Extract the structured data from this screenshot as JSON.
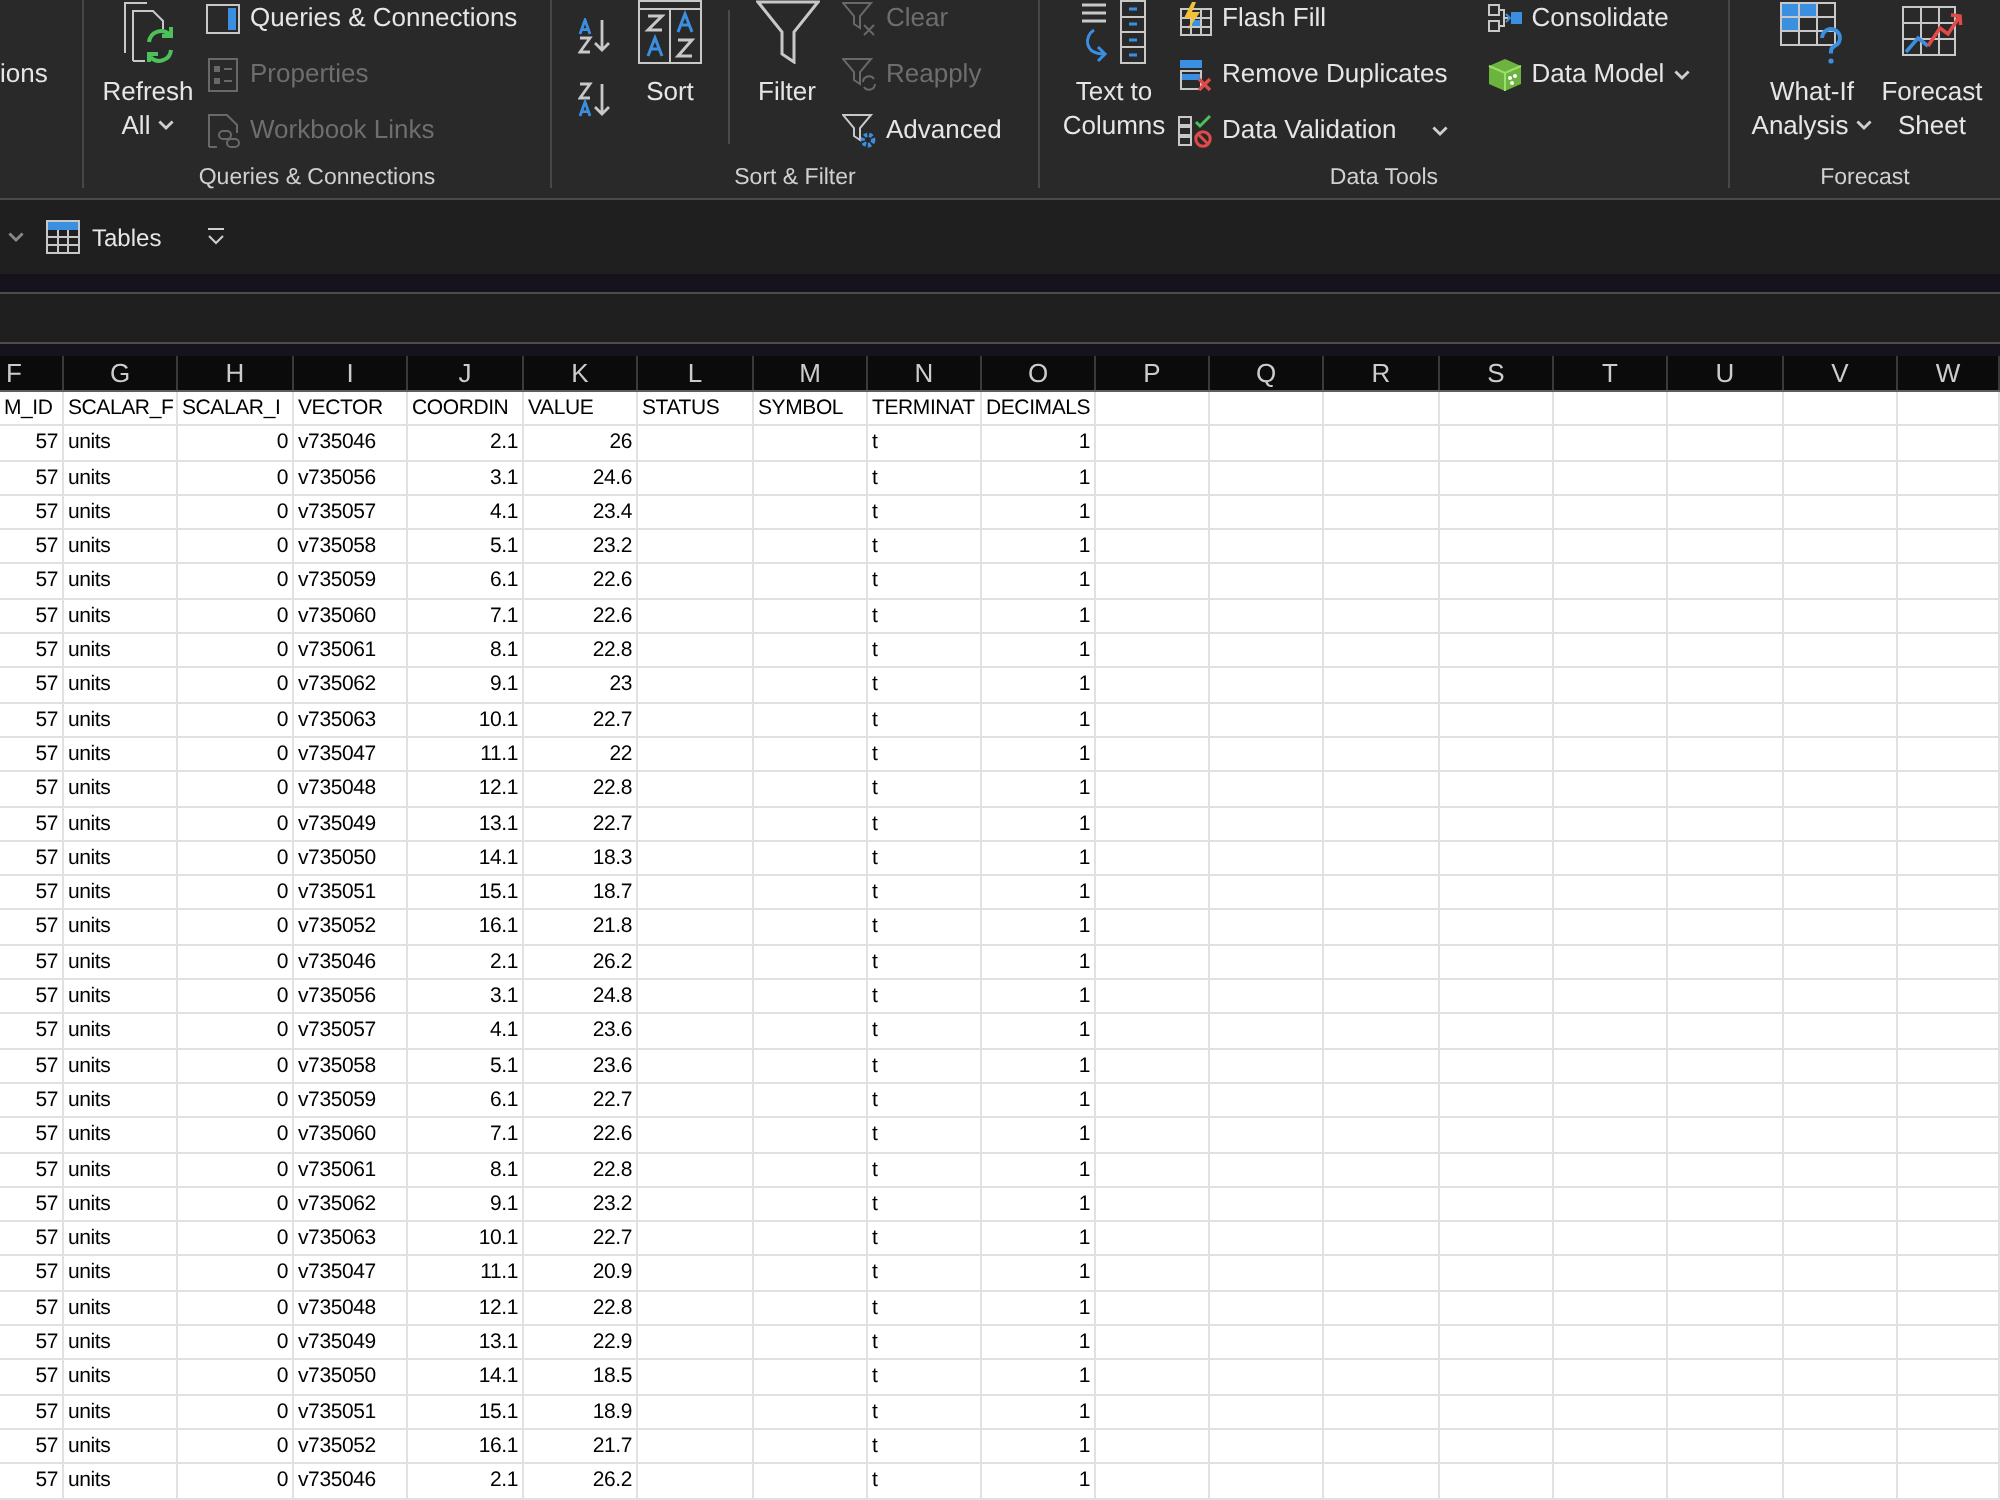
{
  "ribbon": {
    "groups": [
      {
        "columns": [
          {
            "kind": "text",
            "label": "ions"
          }
        ]
      },
      {
        "label": "Queries & Connections",
        "columns": [
          {
            "kind": "large",
            "buttons": [
              {
                "lines": [
                  "Refresh",
                  "All"
                ],
                "dropdown": true,
                "disabled": false
              }
            ]
          },
          {
            "kind": "small",
            "buttons": [
              {
                "label": "Queries & Connections",
                "dropdown": false,
                "disabled": false
              },
              {
                "label": "Properties",
                "dropdown": false,
                "disabled": true
              },
              {
                "label": "Workbook Links",
                "dropdown": false,
                "disabled": true
              }
            ]
          }
        ]
      },
      {
        "label": "Sort & Filter",
        "columns": [
          {
            "kind": "sort-pair"
          },
          {
            "kind": "large",
            "buttons": [
              {
                "lines": [
                  "Sort"
                ],
                "dropdown": false,
                "disabled": false
              }
            ]
          },
          {
            "kind": "separator"
          },
          {
            "kind": "large",
            "buttons": [
              {
                "lines": [
                  "Filter"
                ],
                "dropdown": false,
                "disabled": false
              }
            ]
          },
          {
            "kind": "small",
            "buttons": [
              {
                "label": "Clear",
                "dropdown": false,
                "disabled": true
              },
              {
                "label": "Reapply",
                "dropdown": false,
                "disabled": true
              },
              {
                "label": "Advanced",
                "dropdown": false,
                "disabled": false
              }
            ]
          }
        ]
      },
      {
        "label": "Data Tools",
        "columns": [
          {
            "kind": "large",
            "buttons": [
              {
                "lines": [
                  "Text to",
                  "Columns"
                ],
                "dropdown": false,
                "disabled": false
              }
            ]
          },
          {
            "kind": "small",
            "buttons": [
              {
                "label": "Flash Fill",
                "dropdown": false,
                "disabled": false
              },
              {
                "label": "Remove Duplicates",
                "dropdown": false,
                "disabled": false
              },
              {
                "label": "Data Validation",
                "dropdown": true,
                "disabled": false
              }
            ]
          },
          {
            "kind": "small",
            "buttons": [
              {
                "label": "Consolidate",
                "dropdown": false,
                "disabled": false
              },
              {
                "label": "Data Model",
                "dropdown": true,
                "disabled": false
              }
            ]
          }
        ]
      },
      {
        "label": "Forecast",
        "columns": [
          {
            "kind": "large",
            "buttons": [
              {
                "lines": [
                  "What-If",
                  "Analysis"
                ],
                "dropdown": true,
                "disabled": false
              }
            ]
          },
          {
            "kind": "large",
            "buttons": [
              {
                "lines": [
                  "Forecast",
                  "Sheet"
                ],
                "dropdown": false,
                "disabled": false
              }
            ]
          }
        ]
      }
    ]
  },
  "toolbar": {
    "buttons": [
      {
        "label": "Tables"
      }
    ]
  },
  "sheet": {
    "column_headers": [
      "F",
      "G",
      "H",
      "I",
      "J",
      "K",
      "L",
      "M",
      "N",
      "O",
      "P",
      "Q",
      "R",
      "S",
      "T",
      "U",
      "V",
      "W"
    ],
    "header_row": {
      "cf": "M_ID",
      "cg": "SCALAR_F",
      "ch": "SCALAR_I",
      "ci": "VECTOR",
      "cj": "COORDIN",
      "ck": "VALUE",
      "cl": "STATUS",
      "cm": "SYMBOL",
      "cn": "TERMINAT",
      "co": "DECIMALS"
    },
    "rows": [
      {
        "cf": "57",
        "cg": "units",
        "ch": "0",
        "ci": "v735046",
        "cj": "2.1",
        "ck": "26",
        "cn": "t",
        "co": "1"
      },
      {
        "cf": "57",
        "cg": "units",
        "ch": "0",
        "ci": "v735056",
        "cj": "3.1",
        "ck": "24.6",
        "cn": "t",
        "co": "1"
      },
      {
        "cf": "57",
        "cg": "units",
        "ch": "0",
        "ci": "v735057",
        "cj": "4.1",
        "ck": "23.4",
        "cn": "t",
        "co": "1"
      },
      {
        "cf": "57",
        "cg": "units",
        "ch": "0",
        "ci": "v735058",
        "cj": "5.1",
        "ck": "23.2",
        "cn": "t",
        "co": "1"
      },
      {
        "cf": "57",
        "cg": "units",
        "ch": "0",
        "ci": "v735059",
        "cj": "6.1",
        "ck": "22.6",
        "cn": "t",
        "co": "1"
      },
      {
        "cf": "57",
        "cg": "units",
        "ch": "0",
        "ci": "v735060",
        "cj": "7.1",
        "ck": "22.6",
        "cn": "t",
        "co": "1"
      },
      {
        "cf": "57",
        "cg": "units",
        "ch": "0",
        "ci": "v735061",
        "cj": "8.1",
        "ck": "22.8",
        "cn": "t",
        "co": "1"
      },
      {
        "cf": "57",
        "cg": "units",
        "ch": "0",
        "ci": "v735062",
        "cj": "9.1",
        "ck": "23",
        "cn": "t",
        "co": "1"
      },
      {
        "cf": "57",
        "cg": "units",
        "ch": "0",
        "ci": "v735063",
        "cj": "10.1",
        "ck": "22.7",
        "cn": "t",
        "co": "1"
      },
      {
        "cf": "57",
        "cg": "units",
        "ch": "0",
        "ci": "v735047",
        "cj": "11.1",
        "ck": "22",
        "cn": "t",
        "co": "1"
      },
      {
        "cf": "57",
        "cg": "units",
        "ch": "0",
        "ci": "v735048",
        "cj": "12.1",
        "ck": "22.8",
        "cn": "t",
        "co": "1"
      },
      {
        "cf": "57",
        "cg": "units",
        "ch": "0",
        "ci": "v735049",
        "cj": "13.1",
        "ck": "22.7",
        "cn": "t",
        "co": "1"
      },
      {
        "cf": "57",
        "cg": "units",
        "ch": "0",
        "ci": "v735050",
        "cj": "14.1",
        "ck": "18.3",
        "cn": "t",
        "co": "1"
      },
      {
        "cf": "57",
        "cg": "units",
        "ch": "0",
        "ci": "v735051",
        "cj": "15.1",
        "ck": "18.7",
        "cn": "t",
        "co": "1"
      },
      {
        "cf": "57",
        "cg": "units",
        "ch": "0",
        "ci": "v735052",
        "cj": "16.1",
        "ck": "21.8",
        "cn": "t",
        "co": "1"
      },
      {
        "cf": "57",
        "cg": "units",
        "ch": "0",
        "ci": "v735046",
        "cj": "2.1",
        "ck": "26.2",
        "cn": "t",
        "co": "1"
      },
      {
        "cf": "57",
        "cg": "units",
        "ch": "0",
        "ci": "v735056",
        "cj": "3.1",
        "ck": "24.8",
        "cn": "t",
        "co": "1"
      },
      {
        "cf": "57",
        "cg": "units",
        "ch": "0",
        "ci": "v735057",
        "cj": "4.1",
        "ck": "23.6",
        "cn": "t",
        "co": "1"
      },
      {
        "cf": "57",
        "cg": "units",
        "ch": "0",
        "ci": "v735058",
        "cj": "5.1",
        "ck": "23.6",
        "cn": "t",
        "co": "1"
      },
      {
        "cf": "57",
        "cg": "units",
        "ch": "0",
        "ci": "v735059",
        "cj": "6.1",
        "ck": "22.7",
        "cn": "t",
        "co": "1"
      },
      {
        "cf": "57",
        "cg": "units",
        "ch": "0",
        "ci": "v735060",
        "cj": "7.1",
        "ck": "22.6",
        "cn": "t",
        "co": "1"
      },
      {
        "cf": "57",
        "cg": "units",
        "ch": "0",
        "ci": "v735061",
        "cj": "8.1",
        "ck": "22.8",
        "cn": "t",
        "co": "1"
      },
      {
        "cf": "57",
        "cg": "units",
        "ch": "0",
        "ci": "v735062",
        "cj": "9.1",
        "ck": "23.2",
        "cn": "t",
        "co": "1"
      },
      {
        "cf": "57",
        "cg": "units",
        "ch": "0",
        "ci": "v735063",
        "cj": "10.1",
        "ck": "22.7",
        "cn": "t",
        "co": "1"
      },
      {
        "cf": "57",
        "cg": "units",
        "ch": "0",
        "ci": "v735047",
        "cj": "11.1",
        "ck": "20.9",
        "cn": "t",
        "co": "1"
      },
      {
        "cf": "57",
        "cg": "units",
        "ch": "0",
        "ci": "v735048",
        "cj": "12.1",
        "ck": "22.8",
        "cn": "t",
        "co": "1"
      },
      {
        "cf": "57",
        "cg": "units",
        "ch": "0",
        "ci": "v735049",
        "cj": "13.1",
        "ck": "22.9",
        "cn": "t",
        "co": "1"
      },
      {
        "cf": "57",
        "cg": "units",
        "ch": "0",
        "ci": "v735050",
        "cj": "14.1",
        "ck": "18.5",
        "cn": "t",
        "co": "1"
      },
      {
        "cf": "57",
        "cg": "units",
        "ch": "0",
        "ci": "v735051",
        "cj": "15.1",
        "ck": "18.9",
        "cn": "t",
        "co": "1"
      },
      {
        "cf": "57",
        "cg": "units",
        "ch": "0",
        "ci": "v735052",
        "cj": "16.1",
        "ck": "21.7",
        "cn": "t",
        "co": "1"
      },
      {
        "cf": "57",
        "cg": "units",
        "ch": "0",
        "ci": "v735046",
        "cj": "2.1",
        "ck": "26.2",
        "cn": "t",
        "co": "1"
      }
    ]
  }
}
